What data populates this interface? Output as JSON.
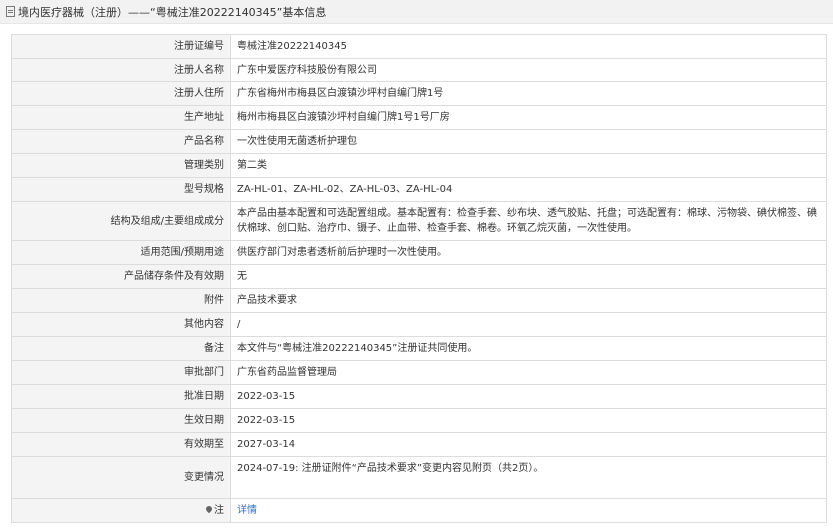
{
  "header": {
    "title": "境内医疗器械（注册）——“粤械注准20222140345”基本信息"
  },
  "rows": [
    {
      "label": "注册证编号",
      "value": "粤械注准20222140345"
    },
    {
      "label": "注册人名称",
      "value": "广东中爱医疗科技股份有限公司"
    },
    {
      "label": "注册人住所",
      "value": "广东省梅州市梅县区白渡镇沙坪村自编门牌1号"
    },
    {
      "label": "生产地址",
      "value": "梅州市梅县区白渡镇沙坪村自编门牌1号1号厂房"
    },
    {
      "label": "产品名称",
      "value": "一次性使用无菌透析护理包"
    },
    {
      "label": "管理类别",
      "value": "第二类"
    },
    {
      "label": "型号规格",
      "value": "ZA-HL-01、ZA-HL-02、ZA-HL-03、ZA-HL-04"
    },
    {
      "label": "结构及组成/主要组成成分",
      "value": "本产品由基本配置和可选配置组成。基本配置有：检查手套、纱布块、透气胶贴、托盘；可选配置有：棉球、污物袋、碘伏棉签、碘伏棉球、创口贴、治疗巾、镊子、止血带、检查手套、棉卷。环氧乙烷灭菌，一次性使用。"
    },
    {
      "label": "适用范围/预期用途",
      "value": "供医疗部门对患者透析前后护理时一次性使用。"
    },
    {
      "label": "产品储存条件及有效期",
      "value": "无"
    },
    {
      "label": "附件",
      "value": "产品技术要求"
    },
    {
      "label": "其他内容",
      "value": "/"
    },
    {
      "label": "备注",
      "value": "本文件与“粤械注准20222140345”注册证共同使用。"
    },
    {
      "label": "审批部门",
      "value": "广东省药品监督管理局"
    },
    {
      "label": "批准日期",
      "value": "2022-03-15"
    },
    {
      "label": "生效日期",
      "value": "2022-03-15"
    },
    {
      "label": "有效期至",
      "value": "2027-03-14"
    },
    {
      "label": "变更情况",
      "value": "2024-07-19: 注册证附件“产品技术要求”变更内容见附页（共2页）。"
    }
  ],
  "note_row": {
    "label": "注",
    "icon": "pin-icon",
    "link_text": "详情"
  },
  "colors": {
    "label_bg": "#f4f4f4",
    "border": "#dcdcdc",
    "link": "#2f6fd1"
  }
}
